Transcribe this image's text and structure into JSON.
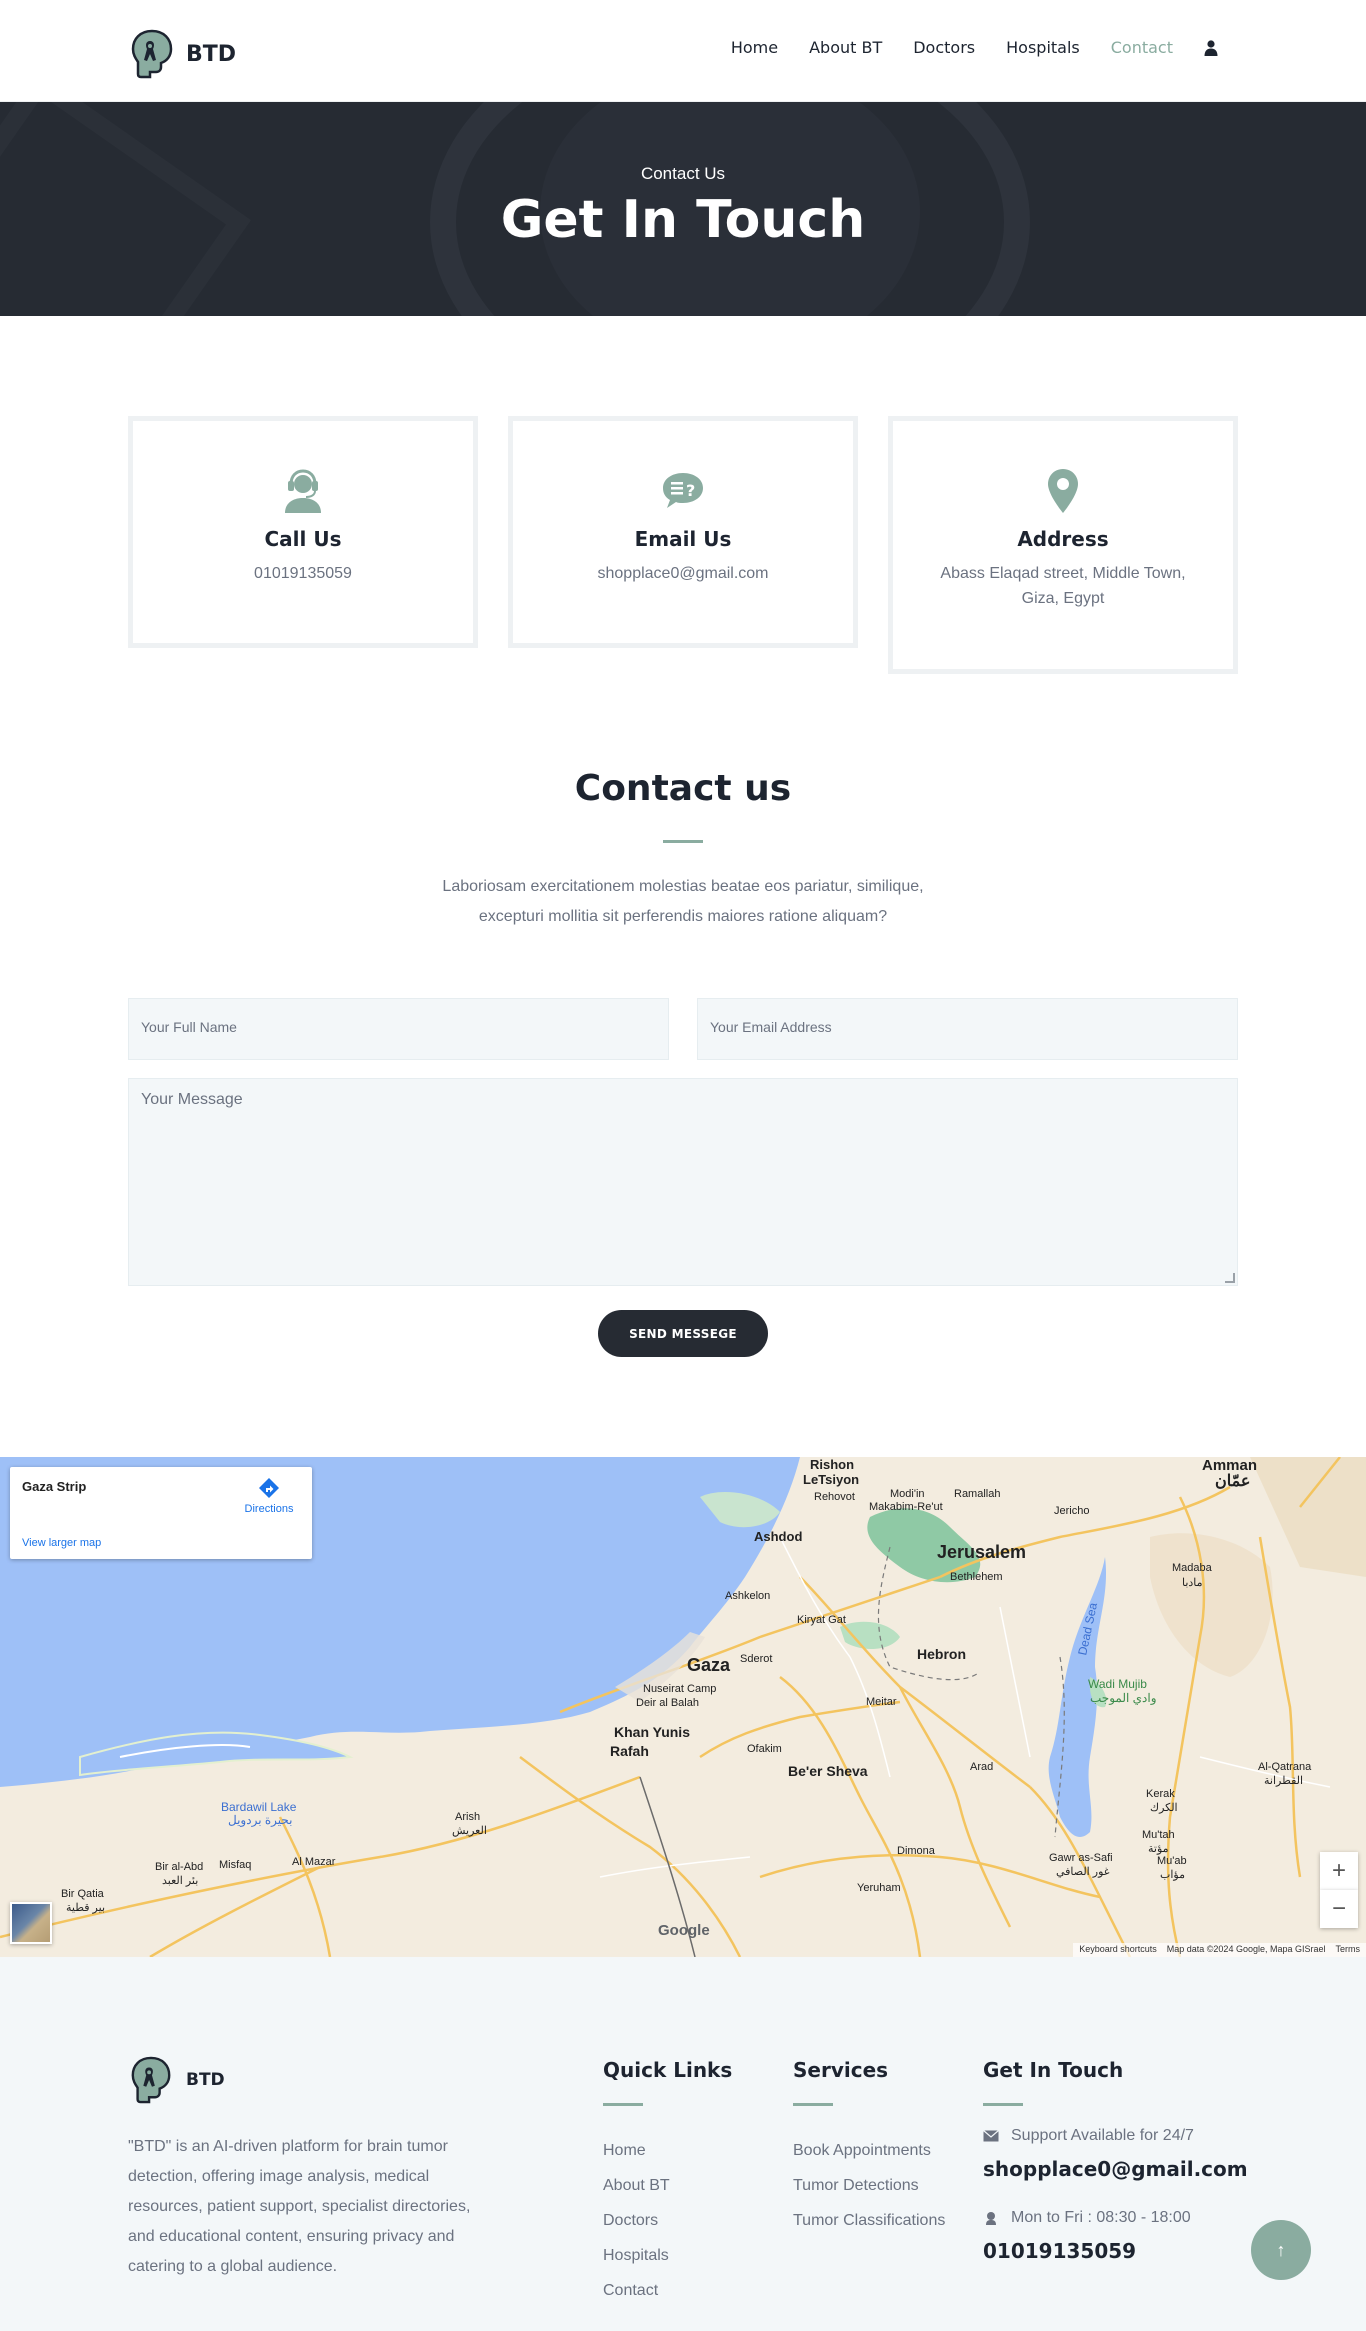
{
  "header": {
    "brand": "BTD",
    "nav": [
      "Home",
      "About BT",
      "Doctors",
      "Hospitals",
      "Contact"
    ],
    "active_nav": "Contact",
    "user_icon": "user-icon"
  },
  "hero": {
    "eyebrow": "Contact Us",
    "title": "Get In Touch"
  },
  "cards": [
    {
      "icon": "headset-icon",
      "title": "Call Us",
      "text": "01019135059"
    },
    {
      "icon": "chat-question-icon",
      "title": "Email Us",
      "text": "shopplace0@gmail.com"
    },
    {
      "icon": "map-pin-icon",
      "title": "Address",
      "text": "Abass Elaqad street, Middle Town, Giza, Egypt"
    }
  ],
  "contact": {
    "title": "Contact us",
    "description": "Laboriosam exercitationem molestias beatae eos pariatur, similique, excepturi mollitia sit perferendis maiores ratione aliquam?",
    "name_placeholder": "Your Full Name",
    "email_placeholder": "Your Email Address",
    "message_placeholder": "Your Message",
    "send_label": "SEND MESSEGE"
  },
  "map": {
    "place": "Gaza Strip",
    "directions": "Directions",
    "larger_map": "View larger map",
    "labels": {
      "amman": "Amman",
      "amman_ar": "عمّان",
      "rishon": "Rishon",
      "letsiyon": "LeTsiyon",
      "rehovot": "Rehovot",
      "modiin": "Modi'in",
      "makabim": "Makabim-Re'ut",
      "ramallah": "Ramallah",
      "jericho": "Jericho",
      "ashdod": "Ashdod",
      "jerusalem": "Jerusalem",
      "bethlehem": "Bethlehem",
      "madaba": "Madaba",
      "madaba_ar": "مادبا",
      "ashkelon": "Ashkelon",
      "kiryat_gat": "Kiryat Gat",
      "gaza": "Gaza",
      "sderot": "Sderot",
      "hebron": "Hebron",
      "nuseirat": "Nuseirat Camp",
      "deir": "Deir al Balah",
      "wadi_mujib": "Wadi Mujib",
      "wadi_mujib_ar": "وادي الموجب",
      "khan_yunis": "Khan Yunis",
      "rafah": "Rafah",
      "ofakim": "Ofakim",
      "beer_sheva": "Be'er Sheva",
      "arad": "Arad",
      "meitar": "Meitar",
      "al_qatrana": "Al-Qatrana",
      "al_qatrana_ar": "القطرانة",
      "kerak": "Kerak",
      "kerak_ar": "الكرك",
      "bardawil": "Bardawil Lake",
      "bardawil_ar": "بحيرة بردويل",
      "arish": "Arish",
      "arish_ar": "العريش",
      "dimona": "Dimona",
      "mutah": "Mu'tah",
      "mutah_ar": "مؤتة",
      "muab": "Mu'ab",
      "muab_ar": "مؤاب",
      "gawr": "Gawr as-Safi",
      "gawr_ar": "غور الصافي",
      "bir_al_abd": "Bir al-Abd",
      "bir_al_abd_ar": "بئر العبد",
      "misfaq": "Misfaq",
      "al_mazar": "Al Mazar",
      "bir_qatia": "Bir Qatia",
      "bir_qatia_ar": "بير قطية",
      "yeruham": "Yeruham",
      "dead_sea": "Dead Sea"
    },
    "zoom_in": "+",
    "zoom_out": "−",
    "google": "Google",
    "keyboard": "Keyboard shortcuts",
    "map_data": "Map data ©2024 Google, Mapa GISrael",
    "terms": "Terms"
  },
  "footer": {
    "brand": "BTD",
    "about": "\"BTD\" is an AI-driven platform for brain tumor detection, offering image analysis, medical resources, patient support, specialist directories, and educational content, ensuring privacy and catering to a global audience.",
    "quick_links_title": "Quick Links",
    "quick_links": [
      "Home",
      "About BT",
      "Doctors",
      "Hospitals",
      "Contact"
    ],
    "services_title": "Services",
    "services": [
      "Book Appointments",
      "Tumor Detections",
      "Tumor Classifications"
    ],
    "touch_title": "Get In Touch",
    "support_text": "Support Available for 24/7",
    "email": "shopplace0@gmail.com",
    "hours_text": "Mon to Fri : 08:30 - 18:00",
    "phone": "01019135059",
    "to_top": "↑"
  },
  "colors": {
    "accent": "#8aaca0",
    "dark": "#262b33",
    "text": "#1d2430",
    "muted": "#6b7280",
    "light_bg": "#f3f7f9"
  }
}
